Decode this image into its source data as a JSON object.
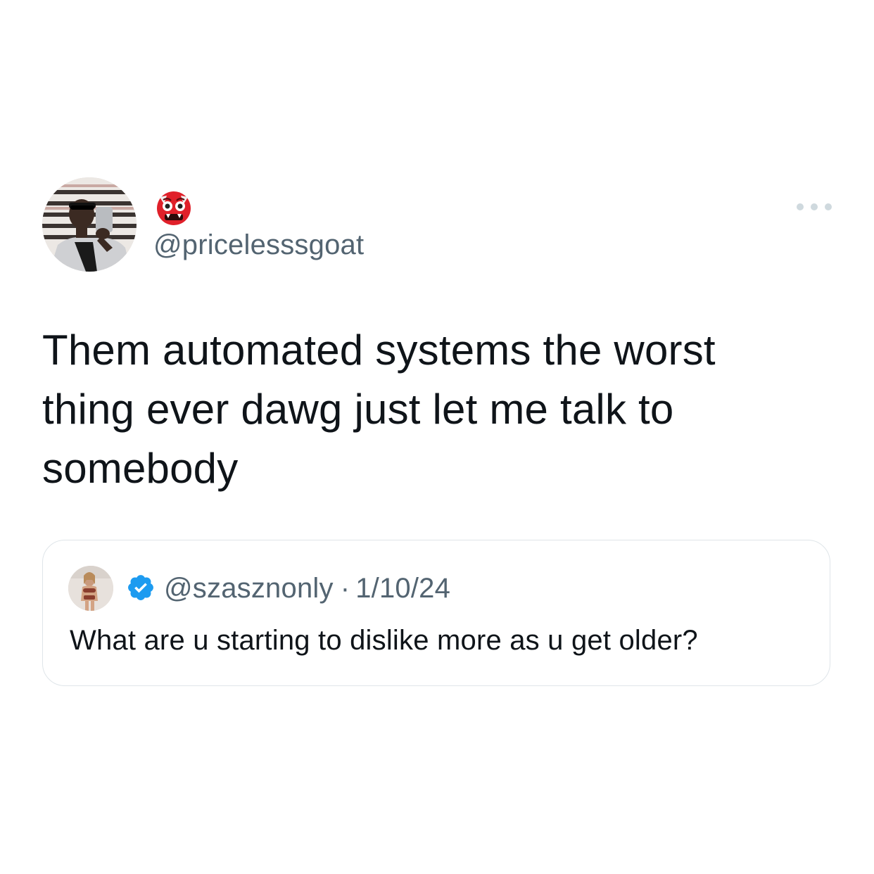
{
  "tweet": {
    "author": {
      "display_name_icon": "ogre-emoji-icon",
      "handle": "@pricelesssgoat"
    },
    "text": "Them automated systems the worst thing ever dawg just let me talk to somebody",
    "menu_icon": "more-horizontal-icon"
  },
  "quoted_tweet": {
    "handle": "@szasznonly",
    "separator": "·",
    "date": "1/10/24",
    "verified_icon": "verified-badge-icon",
    "text": "What are u starting to dislike more as u get older?"
  },
  "colors": {
    "text_primary": "#0f1419",
    "text_secondary": "#536471",
    "verified_blue": "#1d9bf0",
    "border": "#dfe5e9",
    "dots": "#cfd9de"
  }
}
